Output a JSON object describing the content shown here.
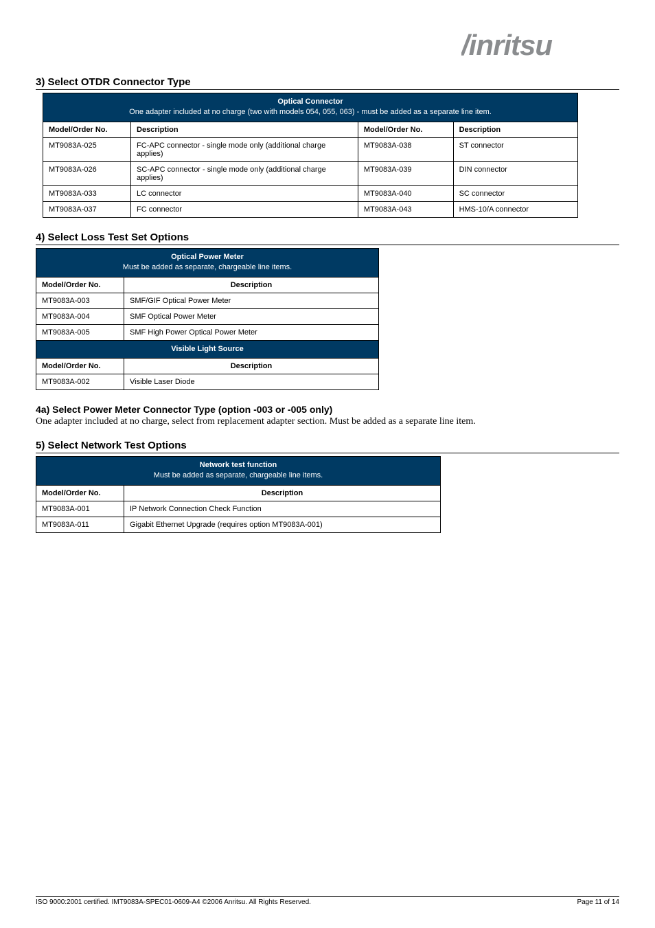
{
  "brand": "Anritsu",
  "section3": {
    "heading": "3) Select OTDR Connector Type",
    "banner_title": "Optical Connector",
    "banner_sub": "One adapter included at no charge (two with models 054, 055, 063) - must be added as a separate line item.",
    "col_model": "Model/Order No.",
    "col_desc": "Description",
    "rows": [
      {
        "m1": "MT9083A-025",
        "d1": "FC-APC connector - single mode only (additional charge applies)",
        "m2": "MT9083A-038",
        "d2": "ST connector"
      },
      {
        "m1": "MT9083A-026",
        "d1": "SC-APC connector - single mode only (additional charge applies)",
        "m2": "MT9083A-039",
        "d2": "DIN connector"
      },
      {
        "m1": "MT9083A-033",
        "d1": "LC connector",
        "m2": "MT9083A-040",
        "d2": "SC connector"
      },
      {
        "m1": "MT9083A-037",
        "d1": "FC connector",
        "m2": "MT9083A-043",
        "d2": "HMS-10/A connector"
      }
    ]
  },
  "section4": {
    "heading": "4) Select Loss Test Set Options",
    "banner1_title": "Optical Power Meter",
    "banner1_sub": "Must be added as separate, chargeable line items.",
    "col_model": "Model/Order No.",
    "col_desc": "Description",
    "rows1": [
      {
        "m": "MT9083A-003",
        "d": "SMF/GIF Optical Power Meter"
      },
      {
        "m": "MT9083A-004",
        "d": "SMF Optical Power Meter"
      },
      {
        "m": "MT9083A-005",
        "d": "SMF High Power Optical Power Meter"
      }
    ],
    "banner2_title": "Visible Light Source",
    "rows2": [
      {
        "m": "MT9083A-002",
        "d": "Visible Laser Diode"
      }
    ]
  },
  "section4a": {
    "heading": "4a) Select Power Meter Connector Type (option -003 or -005 only)",
    "note": "One adapter included at no charge, select from replacement adapter section.  Must be added as a separate line item."
  },
  "section5": {
    "heading": "5) Select Network Test Options",
    "banner_title": "Network test function",
    "banner_sub": "Must be added as separate, chargeable line items.",
    "col_model": "Model/Order No.",
    "col_desc": "Description",
    "rows": [
      {
        "m": "MT9083A-001",
        "d": "IP Network Connection Check Function"
      },
      {
        "m": "MT9083A-011",
        "d": "Gigabit Ethernet Upgrade (requires option MT9083A-001)"
      }
    ]
  },
  "footer": {
    "left": "ISO 9000:2001 certified. IMT9083A-SPEC01-0609-A4 ©2006 Anritsu. All Rights Reserved.",
    "right": "Page 11 of 14"
  }
}
